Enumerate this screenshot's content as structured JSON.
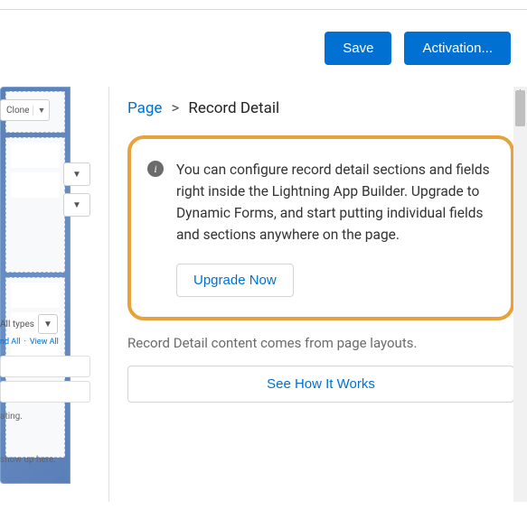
{
  "toolbar": {
    "save": "Save",
    "activation": "Activation..."
  },
  "leftPane": {
    "clone": "Clone",
    "allTypes": "All types",
    "expandAll": "nd All",
    "viewAll": "View All",
    "hint1": "ating.",
    "hint2": "show up here."
  },
  "breadcrumb": {
    "root": "Page",
    "sep": ">",
    "current": "Record Detail"
  },
  "callout": {
    "text": "You can configure record detail sections and fields right inside the Lightning App Builder. Upgrade to Dynamic Forms, and start putting individual fields and sections anywhere on the page.",
    "upgrade": "Upgrade Now"
  },
  "subNote": "Record Detail content comes from page layouts.",
  "seeHow": "See How It Works"
}
